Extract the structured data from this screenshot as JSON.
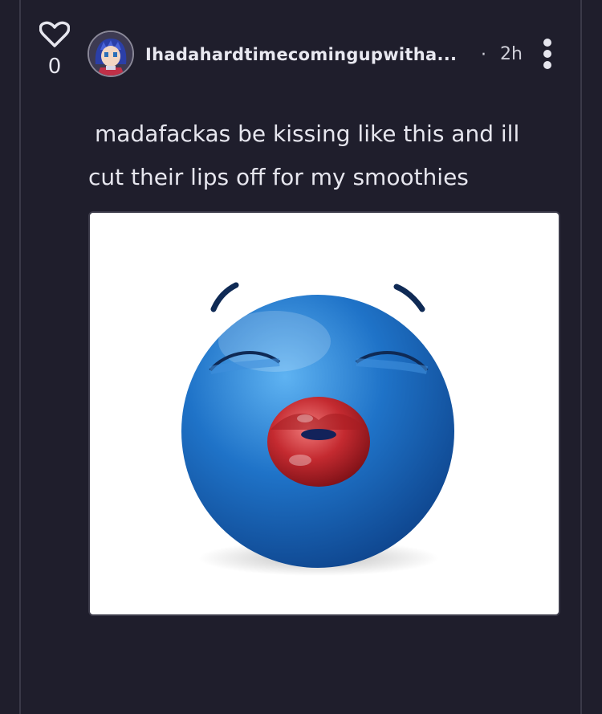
{
  "post": {
    "likes": "0",
    "username": "Ihadahardtimecomingupwitha...",
    "separator": "·",
    "time": "2h",
    "text_line1": "madafackas be kissing like this and ill",
    "text_line2": "cut their lips off for my smoothies"
  },
  "icons": {
    "like": "heart-outline-icon",
    "menu": "more-vertical-icon"
  },
  "colors": {
    "background": "#1f1e2c",
    "text": "#e6e6ee",
    "emoji_blue": "#1f73c8",
    "lips_red": "#b8282e"
  }
}
